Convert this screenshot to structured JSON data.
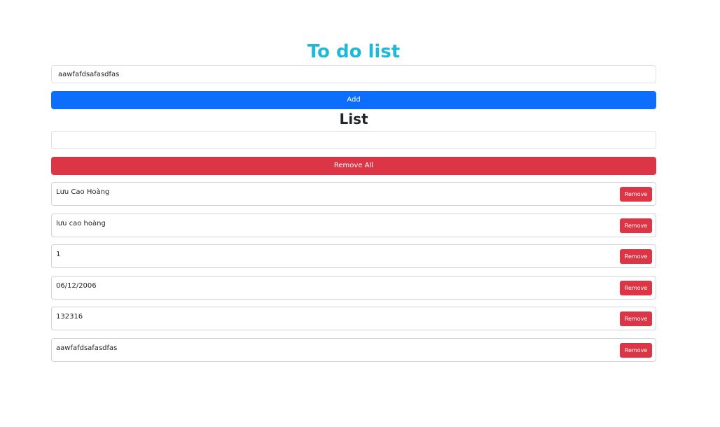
{
  "header": {
    "title": "To do list"
  },
  "add_form": {
    "input_value": "aawfafdsafasdfas",
    "add_label": "Add"
  },
  "list_section": {
    "title": "List",
    "input_value": "",
    "remove_all_label": "Remove All"
  },
  "items": [
    {
      "text": "Lưu Cao Hoàng",
      "remove_label": "Remove"
    },
    {
      "text": "lưu cao hoàng",
      "remove_label": "Remove"
    },
    {
      "text": "1",
      "remove_label": "Remove"
    },
    {
      "text": "06/12/2006",
      "remove_label": "Remove"
    },
    {
      "text": "132316",
      "remove_label": "Remove"
    },
    {
      "text": "aawfafdsafasdfas",
      "remove_label": "Remove"
    }
  ],
  "colors": {
    "title": "#1fb8d8",
    "primary": "#0d6efd",
    "danger": "#dc3545",
    "border": "#dee2e6"
  }
}
